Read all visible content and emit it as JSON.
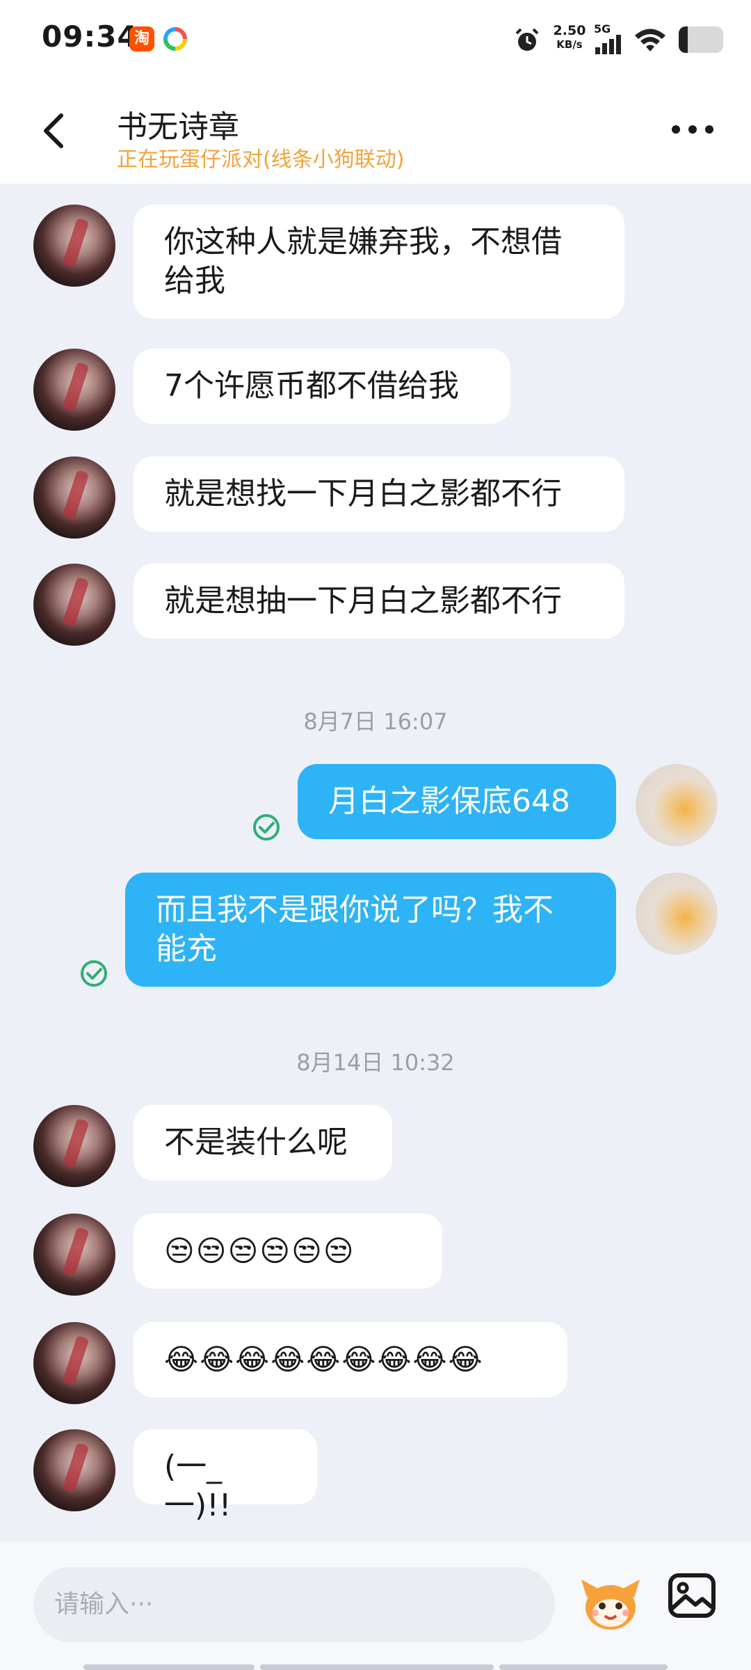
{
  "status_bar": {
    "time": "09:34",
    "app_taobao_label": "淘",
    "net_speed_value": "2.50",
    "net_speed_unit": "KB/s",
    "network": "5G",
    "battery_level": 0.2
  },
  "header": {
    "contact_name": "书无诗章",
    "contact_status": "正在玩蛋仔派对(线条小狗联动)",
    "back_icon": "chevron-left-icon",
    "more_icon": "more-horizontal-icon"
  },
  "messages": [
    {
      "from": "them",
      "text": "你这种人就是嫌弃我，不想借\n给我"
    },
    {
      "from": "them",
      "text": "7个许愿币都不借给我"
    },
    {
      "from": "them",
      "text": "就是想找一下月白之影都不行"
    },
    {
      "from": "them",
      "text": "就是想抽一下月白之影都不行"
    },
    {
      "type": "timestamp",
      "text": "8月7日 16:07"
    },
    {
      "from": "me",
      "text": "月白之影保底648",
      "read": true
    },
    {
      "from": "me",
      "text": "而且我不是跟你说了吗？我不\n能充",
      "read": true
    },
    {
      "type": "timestamp",
      "text": "8月14日 10:32"
    },
    {
      "from": "them",
      "text": "不是装什么呢"
    },
    {
      "from": "them",
      "text": "😒😒😒😒😒😒"
    },
    {
      "from": "them",
      "text": "😂😂😂😂😂😂😂😂😂"
    },
    {
      "from": "them",
      "text": "(一_一)!!"
    }
  ],
  "input_bar": {
    "placeholder": "请输入···",
    "mascot_icon": "egg-party-mascot-icon",
    "image_icon": "image-icon"
  },
  "colors": {
    "accent_blue": "#2db3f6",
    "status_orange": "#f2a23a",
    "read_green": "#2fae74",
    "background": "#eef0f8"
  }
}
